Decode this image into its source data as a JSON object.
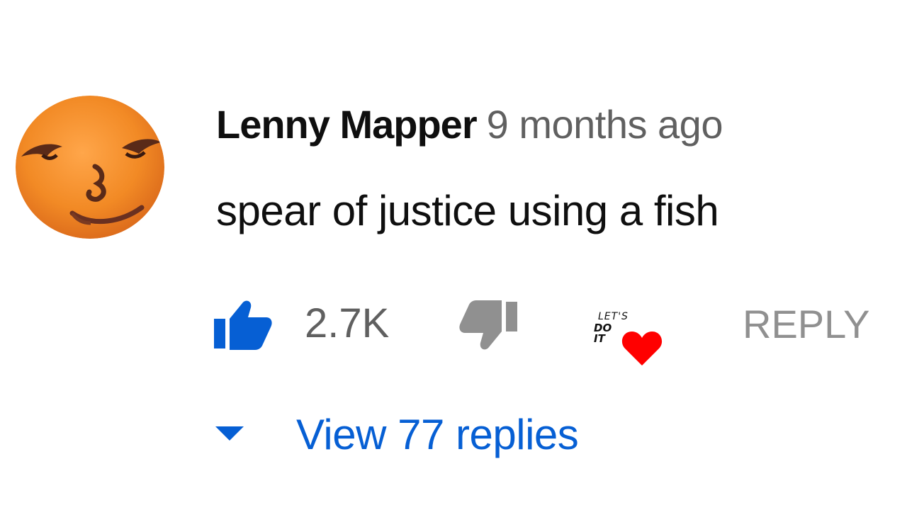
{
  "comment": {
    "author": "Lenny Mapper",
    "timestamp": "9 months ago",
    "text": "spear of justice using a fish",
    "avatar_icon": "orange-face-avatar",
    "avatar_color": "#f08a2a"
  },
  "actions": {
    "like_icon": "thumbs-up-icon",
    "like_count": "2.7K",
    "like_color": "#065fd4",
    "dislike_icon": "thumbs-down-icon",
    "dislike_color": "#909090",
    "creator_heart": {
      "icon": "creator-heart-icon",
      "badge_line1": "LET'S",
      "badge_line2": "DO IT",
      "heart_color": "#ff0000"
    },
    "reply_label": "REPLY",
    "reply_color": "#909090"
  },
  "replies": {
    "caret_icon": "caret-down-icon",
    "label": "View 77 replies",
    "color": "#065fd4"
  }
}
